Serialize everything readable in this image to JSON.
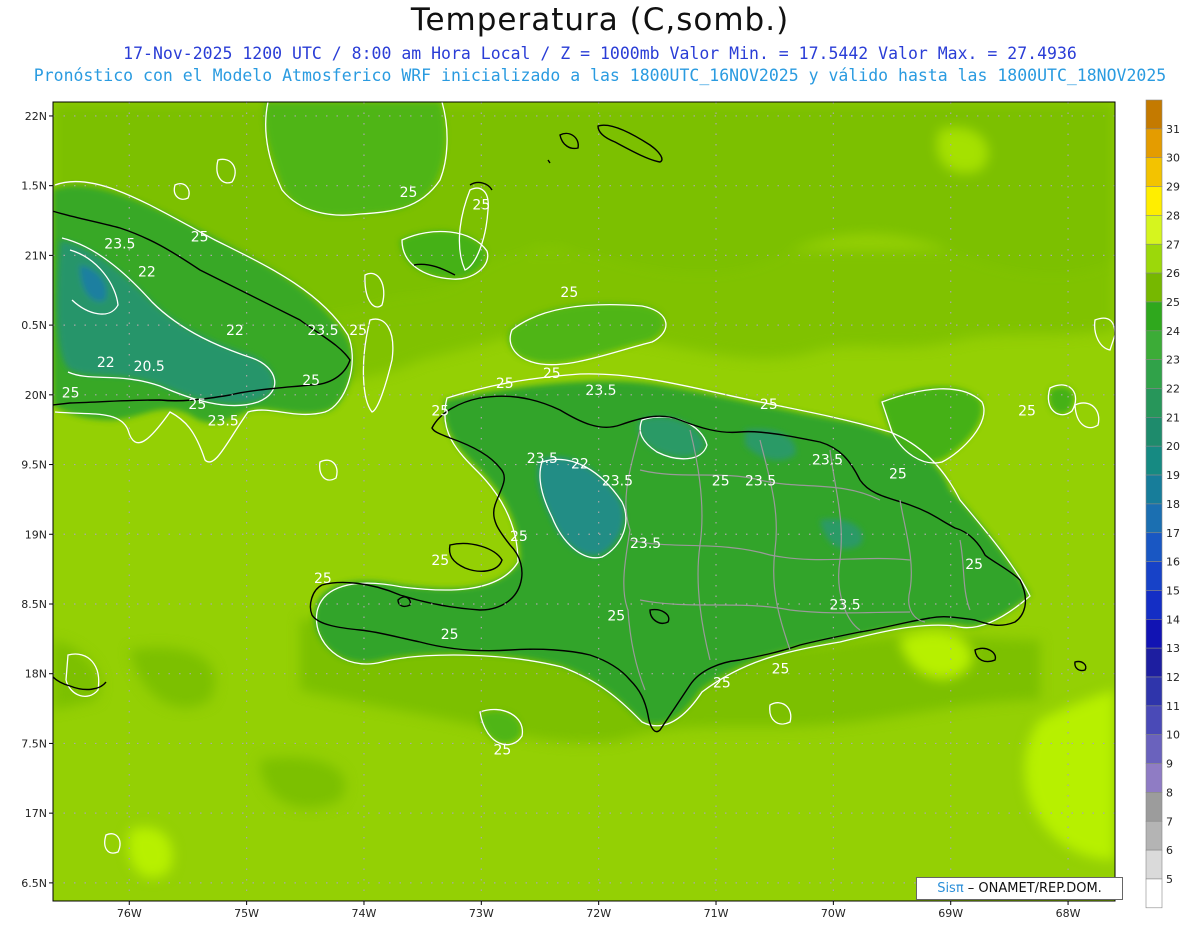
{
  "title": "Temperatura (C,somb.)",
  "subtitle_line1": "17-Nov-2025  1200 UTC / 8:00 am Hora Local / Z = 1000mb   Valor Min. = 17.5442  Valor Max. = 27.4936",
  "subtitle_line2": "Pronóstico con el Modelo Atmosferico WRF inicializado a las 1800UTC_16NOV2025 y válido hasta las  1800UTC_18NOV2025",
  "credit": {
    "sis": "Sisπ",
    "rest": " – ONAMET/REP.DOM."
  },
  "map": {
    "lon_range": [
      -76.65,
      -67.6
    ],
    "lat_range": [
      16.37,
      22.1
    ],
    "lat_ticks": [
      {
        "lat": 22.0,
        "label": "22N"
      },
      {
        "lat": 21.5,
        "label": "1.5N"
      },
      {
        "lat": 21.0,
        "label": "21N"
      },
      {
        "lat": 20.5,
        "label": "0.5N"
      },
      {
        "lat": 20.0,
        "label": "20N"
      },
      {
        "lat": 19.5,
        "label": "9.5N"
      },
      {
        "lat": 19.0,
        "label": "19N"
      },
      {
        "lat": 18.5,
        "label": "8.5N"
      },
      {
        "lat": 18.0,
        "label": "18N"
      },
      {
        "lat": 17.5,
        "label": "7.5N"
      },
      {
        "lat": 17.0,
        "label": "17N"
      },
      {
        "lat": 16.5,
        "label": "6.5N"
      }
    ],
    "lon_ticks": [
      {
        "lon": -76,
        "label": "76W"
      },
      {
        "lon": -75,
        "label": "75W"
      },
      {
        "lon": -74,
        "label": "74W"
      },
      {
        "lon": -73,
        "label": "73W"
      },
      {
        "lon": -72,
        "label": "72W"
      },
      {
        "lon": -71,
        "label": "71W"
      },
      {
        "lon": -70,
        "label": "70W"
      },
      {
        "lon": -69,
        "label": "69W"
      },
      {
        "lon": -68,
        "label": "68W"
      }
    ],
    "contour_labels": [
      {
        "lon": -73.62,
        "lat": 21.42,
        "text": "25"
      },
      {
        "lon": -73.0,
        "lat": 21.33,
        "text": "25"
      },
      {
        "lon": -75.4,
        "lat": 21.1,
        "text": "25"
      },
      {
        "lon": -76.08,
        "lat": 21.05,
        "text": "23.5"
      },
      {
        "lon": -75.85,
        "lat": 20.85,
        "text": "22"
      },
      {
        "lon": -75.1,
        "lat": 20.43,
        "text": "22"
      },
      {
        "lon": -74.35,
        "lat": 20.43,
        "text": "23.5"
      },
      {
        "lon": -74.05,
        "lat": 20.43,
        "text": "25"
      },
      {
        "lon": -76.2,
        "lat": 20.2,
        "text": "22"
      },
      {
        "lon": -75.83,
        "lat": 20.17,
        "text": "20.5"
      },
      {
        "lon": -76.5,
        "lat": 19.98,
        "text": "25"
      },
      {
        "lon": -74.45,
        "lat": 20.07,
        "text": "25"
      },
      {
        "lon": -75.42,
        "lat": 19.9,
        "text": "25"
      },
      {
        "lon": -75.2,
        "lat": 19.78,
        "text": "23.5"
      },
      {
        "lon": -72.25,
        "lat": 20.7,
        "text": "25"
      },
      {
        "lon": -72.4,
        "lat": 20.12,
        "text": "25"
      },
      {
        "lon": -72.8,
        "lat": 20.05,
        "text": "25"
      },
      {
        "lon": -73.35,
        "lat": 19.85,
        "text": "25"
      },
      {
        "lon": -71.98,
        "lat": 20.0,
        "text": "23.5"
      },
      {
        "lon": -72.48,
        "lat": 19.51,
        "text": "23.5"
      },
      {
        "lon": -72.16,
        "lat": 19.47,
        "text": "22"
      },
      {
        "lon": -71.84,
        "lat": 19.35,
        "text": "23.5"
      },
      {
        "lon": -70.96,
        "lat": 19.35,
        "text": "25"
      },
      {
        "lon": -70.62,
        "lat": 19.35,
        "text": "23.5"
      },
      {
        "lon": -70.05,
        "lat": 19.5,
        "text": "23.5"
      },
      {
        "lon": -70.55,
        "lat": 19.9,
        "text": "25"
      },
      {
        "lon": -69.45,
        "lat": 19.4,
        "text": "25"
      },
      {
        "lon": -68.35,
        "lat": 19.85,
        "text": "25"
      },
      {
        "lon": -72.68,
        "lat": 18.95,
        "text": "25"
      },
      {
        "lon": -71.6,
        "lat": 18.9,
        "text": "23.5"
      },
      {
        "lon": -73.35,
        "lat": 18.78,
        "text": "25"
      },
      {
        "lon": -68.8,
        "lat": 18.75,
        "text": "25"
      },
      {
        "lon": -69.9,
        "lat": 18.46,
        "text": "23.5"
      },
      {
        "lon": -74.35,
        "lat": 18.65,
        "text": "25"
      },
      {
        "lon": -71.85,
        "lat": 18.38,
        "text": "25"
      },
      {
        "lon": -73.27,
        "lat": 18.25,
        "text": "25"
      },
      {
        "lon": -70.45,
        "lat": 18.0,
        "text": "25"
      },
      {
        "lon": -70.95,
        "lat": 17.9,
        "text": "25"
      },
      {
        "lon": -72.82,
        "lat": 17.42,
        "text": "25"
      }
    ]
  },
  "colorbar": {
    "labels": [
      "31",
      "30",
      "29",
      "28",
      "27",
      "26",
      "25",
      "24",
      "23",
      "22",
      "21",
      "20",
      "19",
      "18",
      "17",
      "16",
      "15",
      "14",
      "13",
      "12",
      "11",
      "10",
      "9",
      "8",
      "7",
      "6",
      "5"
    ],
    "colors": [
      "#c47a00",
      "#e49c00",
      "#f3c300",
      "#ffee00",
      "#d6f51e",
      "#9cd80a",
      "#76b800",
      "#2fa81d",
      "#3cac37",
      "#30a249",
      "#27965a",
      "#1e8b6c",
      "#168a82",
      "#177d9a",
      "#1b6fb1",
      "#1957c3",
      "#1742c8",
      "#142ec5",
      "#1113b3",
      "#1d1ea0",
      "#2f35ab",
      "#4a4ab7",
      "#6a62bd",
      "#8f7cc4",
      "#9c9c9c",
      "#b4b4b4",
      "#dadada",
      "#ffffff"
    ]
  }
}
